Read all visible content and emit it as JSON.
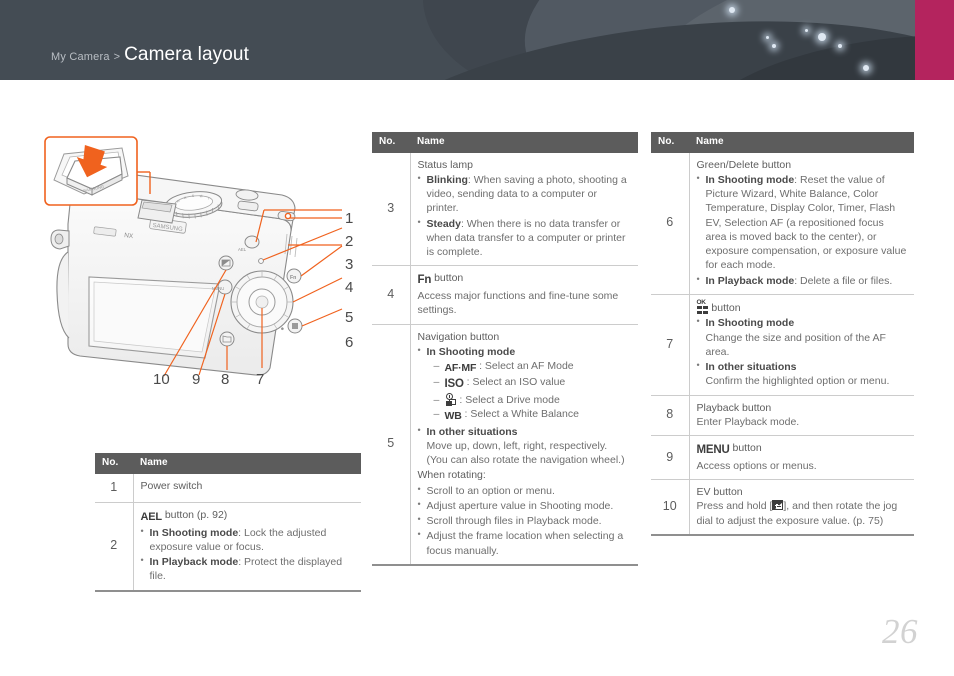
{
  "header": {
    "breadcrumb_parent": "My Camera",
    "breadcrumb_separator": ">",
    "title": "Camera layout",
    "accent_color": "#b4245e",
    "band_color": "#444c54"
  },
  "figure": {
    "alt": "Rear view of camera with numbered callouts 1 to 10",
    "callouts": [
      "1",
      "2",
      "3",
      "4",
      "5",
      "6",
      "7",
      "8",
      "9",
      "10"
    ],
    "inset_label": "SAMSUNG",
    "callout_color": "#f0621e"
  },
  "tables": {
    "columns": {
      "no": "No.",
      "name": "Name"
    },
    "left": [
      {
        "no": "1",
        "title": "Power switch",
        "bullets": []
      },
      {
        "no": "2",
        "title_icon": "AEL",
        "title_rest": " button (p. 92)",
        "bullets": [
          {
            "label": "In Shooting mode",
            "text": ": Lock the adjusted exposure value or focus."
          },
          {
            "label": "In Playback mode",
            "text": ": Protect the displayed file."
          }
        ]
      }
    ],
    "mid": [
      {
        "no": "3",
        "title": "Status lamp",
        "bullets": [
          {
            "label": "Blinking",
            "text": ": When saving a photo, shooting a video, sending data to a computer or printer."
          },
          {
            "label": "Steady",
            "text": ": When there is no data transfer or when data transfer to a computer or printer is complete."
          }
        ]
      },
      {
        "no": "4",
        "title_icon": "Fn",
        "title_rest": " button",
        "desc": "Access major functions and fine-tune some settings."
      },
      {
        "no": "5",
        "title": "Navigation button",
        "bullets": [
          {
            "label": "In Shooting mode"
          },
          {
            "label": "In other situations",
            "sub": "Move up, down, left, right, respectively. (You can also rotate the navigation wheel.)"
          }
        ],
        "nav_items": [
          {
            "icon": "AF·MF",
            "text": " : Select an AF Mode"
          },
          {
            "icon": "ISO",
            "text": " : Select an ISO value"
          },
          {
            "icon": "drive-mode-icon",
            "text": " : Select a Drive mode"
          },
          {
            "icon": "WB",
            "text": " : Select a White Balance"
          }
        ],
        "rotating_heading": "When rotating:",
        "rotating": [
          "Scroll to an option or menu.",
          "Adjust aperture value in Shooting mode.",
          "Scroll through files in Playback mode.",
          "Adjust the frame location when selecting a focus manually."
        ]
      }
    ],
    "right": [
      {
        "no": "6",
        "title": "Green/Delete button",
        "bullets": [
          {
            "label": "In Shooting mode",
            "text": ": Reset the value of Picture Wizard, White Balance, Color Temperature, Display Color, Timer, Flash EV, Selection AF (a repositioned focus area is moved back to the center), or exposure compensation, or exposure value for each mode."
          },
          {
            "label": "In Playback mode",
            "text": ": Delete a file or files."
          }
        ]
      },
      {
        "no": "7",
        "title_icon": "ok-grid-icon",
        "title_rest": " button",
        "bullets": [
          {
            "label": "In Shooting mode",
            "sub": "Change the size and position of the AF area."
          },
          {
            "label": "In other situations",
            "sub": "Confirm the highlighted option or menu."
          }
        ]
      },
      {
        "no": "8",
        "title": "Playback button",
        "desc": "Enter Playback mode."
      },
      {
        "no": "9",
        "title_icon": "MENU",
        "title_rest": " button",
        "desc": "Access options or menus."
      },
      {
        "no": "10",
        "title": "EV button",
        "desc_pre": "Press and hold [",
        "desc_icon": "ev-icon",
        "desc_post": "], and then rotate the jog dial to adjust the exposure value. (p. 75)"
      }
    ]
  },
  "footer": {
    "page_number": "26"
  }
}
